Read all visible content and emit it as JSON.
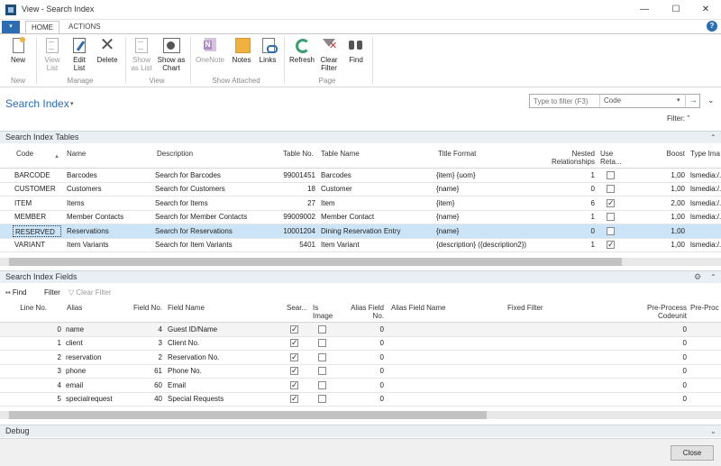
{
  "window": {
    "title": "View - Search Index",
    "minimize": "—",
    "maximize": "☐",
    "close": "✕"
  },
  "ribbon": {
    "file_glyph": "▾",
    "tabs": [
      "HOME",
      "ACTIONS"
    ],
    "help_glyph": "?",
    "groups": [
      "New",
      "Manage",
      "View",
      "Show Attached",
      "Page"
    ],
    "buttons": {
      "new": "New",
      "view_list": [
        "View",
        "List"
      ],
      "edit_list": [
        "Edit",
        "List"
      ],
      "delete": "Delete",
      "show_as_list": [
        "Show",
        "as List"
      ],
      "show_as_chart": [
        "Show as",
        "Chart"
      ],
      "onenote": "OneNote",
      "notes": "Notes",
      "links": "Links",
      "refresh": "Refresh",
      "clear_filter": [
        "Clear",
        "Filter"
      ],
      "find": "Find"
    }
  },
  "header": {
    "title": "Search Index",
    "filter_placeholder": "Type to filter (F3)",
    "filter_field": "Code",
    "filter_status": "Filter: ''"
  },
  "tables_part": {
    "title": "Search Index Tables",
    "columns": {
      "code": "Code",
      "name": "Name",
      "description": "Description",
      "table_no": "Table No.",
      "table_name": "Table Name",
      "item_format": "Title Format",
      "nested": [
        "Nested",
        "Relationships"
      ],
      "use_retain": [
        "Use",
        "Reta..."
      ],
      "boost": "Boost",
      "type_image": "Type Ima"
    },
    "rows": [
      {
        "code": "BARCODE",
        "name": "Barcodes",
        "description": "Search for Barcodes",
        "table_no": "99001451",
        "table_name": "Barcodes",
        "format": "{item} {uom}",
        "nested": "1",
        "retain": false,
        "boost": "1,00",
        "type_image": "lsmedia:/..."
      },
      {
        "code": "CUSTOMER",
        "name": "Customers",
        "description": "Search for Customers",
        "table_no": "18",
        "table_name": "Customer",
        "format": "{name}",
        "nested": "0",
        "retain": false,
        "boost": "1,00",
        "type_image": "lsmedia:/..."
      },
      {
        "code": "ITEM",
        "name": "Items",
        "description": "Search for Items",
        "table_no": "27",
        "table_name": "Item",
        "format": "{item}",
        "nested": "6",
        "retain": true,
        "boost": "2,00",
        "type_image": "lsmedia:/..."
      },
      {
        "code": "MEMBER",
        "name": "Member Contacts",
        "description": "Search for Member Contacts",
        "table_no": "99009002",
        "table_name": "Member Contact",
        "format": "{name}",
        "nested": "1",
        "retain": false,
        "boost": "1,00",
        "type_image": "lsmedia:/..."
      },
      {
        "code": "RESERVED",
        "name": "Reservations",
        "description": "Search for Reservations",
        "table_no": "10001204",
        "table_name": "Dining Reservation Entry",
        "format": "{name}",
        "nested": "0",
        "retain": false,
        "boost": "1,00",
        "type_image": ""
      },
      {
        "code": "VARIANT",
        "name": "Item Variants",
        "description": "Search for Item Variants",
        "table_no": "5401",
        "table_name": "Item Variant",
        "format": "{description} ({description2})",
        "nested": "1",
        "retain": true,
        "boost": "1,00",
        "type_image": "lsmedia:/..."
      }
    ]
  },
  "fields_part": {
    "title": "Search Index Fields",
    "toolbar": {
      "find": "Find",
      "filter": "Filter",
      "clear_filter": "Clear Filter"
    },
    "columns": {
      "line_no": "Line No.",
      "alias": "Alias",
      "field_no": "Field No.",
      "field_name": "Field Name",
      "searchable": "Sear...",
      "is_image": [
        "Is",
        "Image"
      ],
      "alias_field_no": [
        "Alias Field",
        "No."
      ],
      "alias_field_name": "Alias Field Name",
      "fixed_filter": "Fixed Filter",
      "preprocess": [
        "Pre-Process",
        "Codeunit"
      ],
      "preprocess2": "Pre-Proc"
    },
    "rows": [
      {
        "line_no": "0",
        "alias": "name",
        "field_no": "4",
        "field_name": "Guest ID/Name",
        "searchable": true,
        "is_image": false,
        "alias_field_no": "0",
        "preprocess": "0"
      },
      {
        "line_no": "1",
        "alias": "client",
        "field_no": "3",
        "field_name": "Client No.",
        "searchable": true,
        "is_image": false,
        "alias_field_no": "0",
        "preprocess": "0"
      },
      {
        "line_no": "2",
        "alias": "reservation",
        "field_no": "2",
        "field_name": "Reservation No.",
        "searchable": true,
        "is_image": false,
        "alias_field_no": "0",
        "preprocess": "0"
      },
      {
        "line_no": "3",
        "alias": "phone",
        "field_no": "61",
        "field_name": "Phone No.",
        "searchable": true,
        "is_image": false,
        "alias_field_no": "0",
        "preprocess": "0"
      },
      {
        "line_no": "4",
        "alias": "email",
        "field_no": "60",
        "field_name": "Email",
        "searchable": true,
        "is_image": false,
        "alias_field_no": "0",
        "preprocess": "0"
      },
      {
        "line_no": "5",
        "alias": "specialrequest",
        "field_no": "40",
        "field_name": "Special Requests",
        "searchable": true,
        "is_image": false,
        "alias_field_no": "0",
        "preprocess": "0"
      }
    ]
  },
  "debug_part": {
    "title": "Debug"
  },
  "footer": {
    "close": "Close"
  }
}
